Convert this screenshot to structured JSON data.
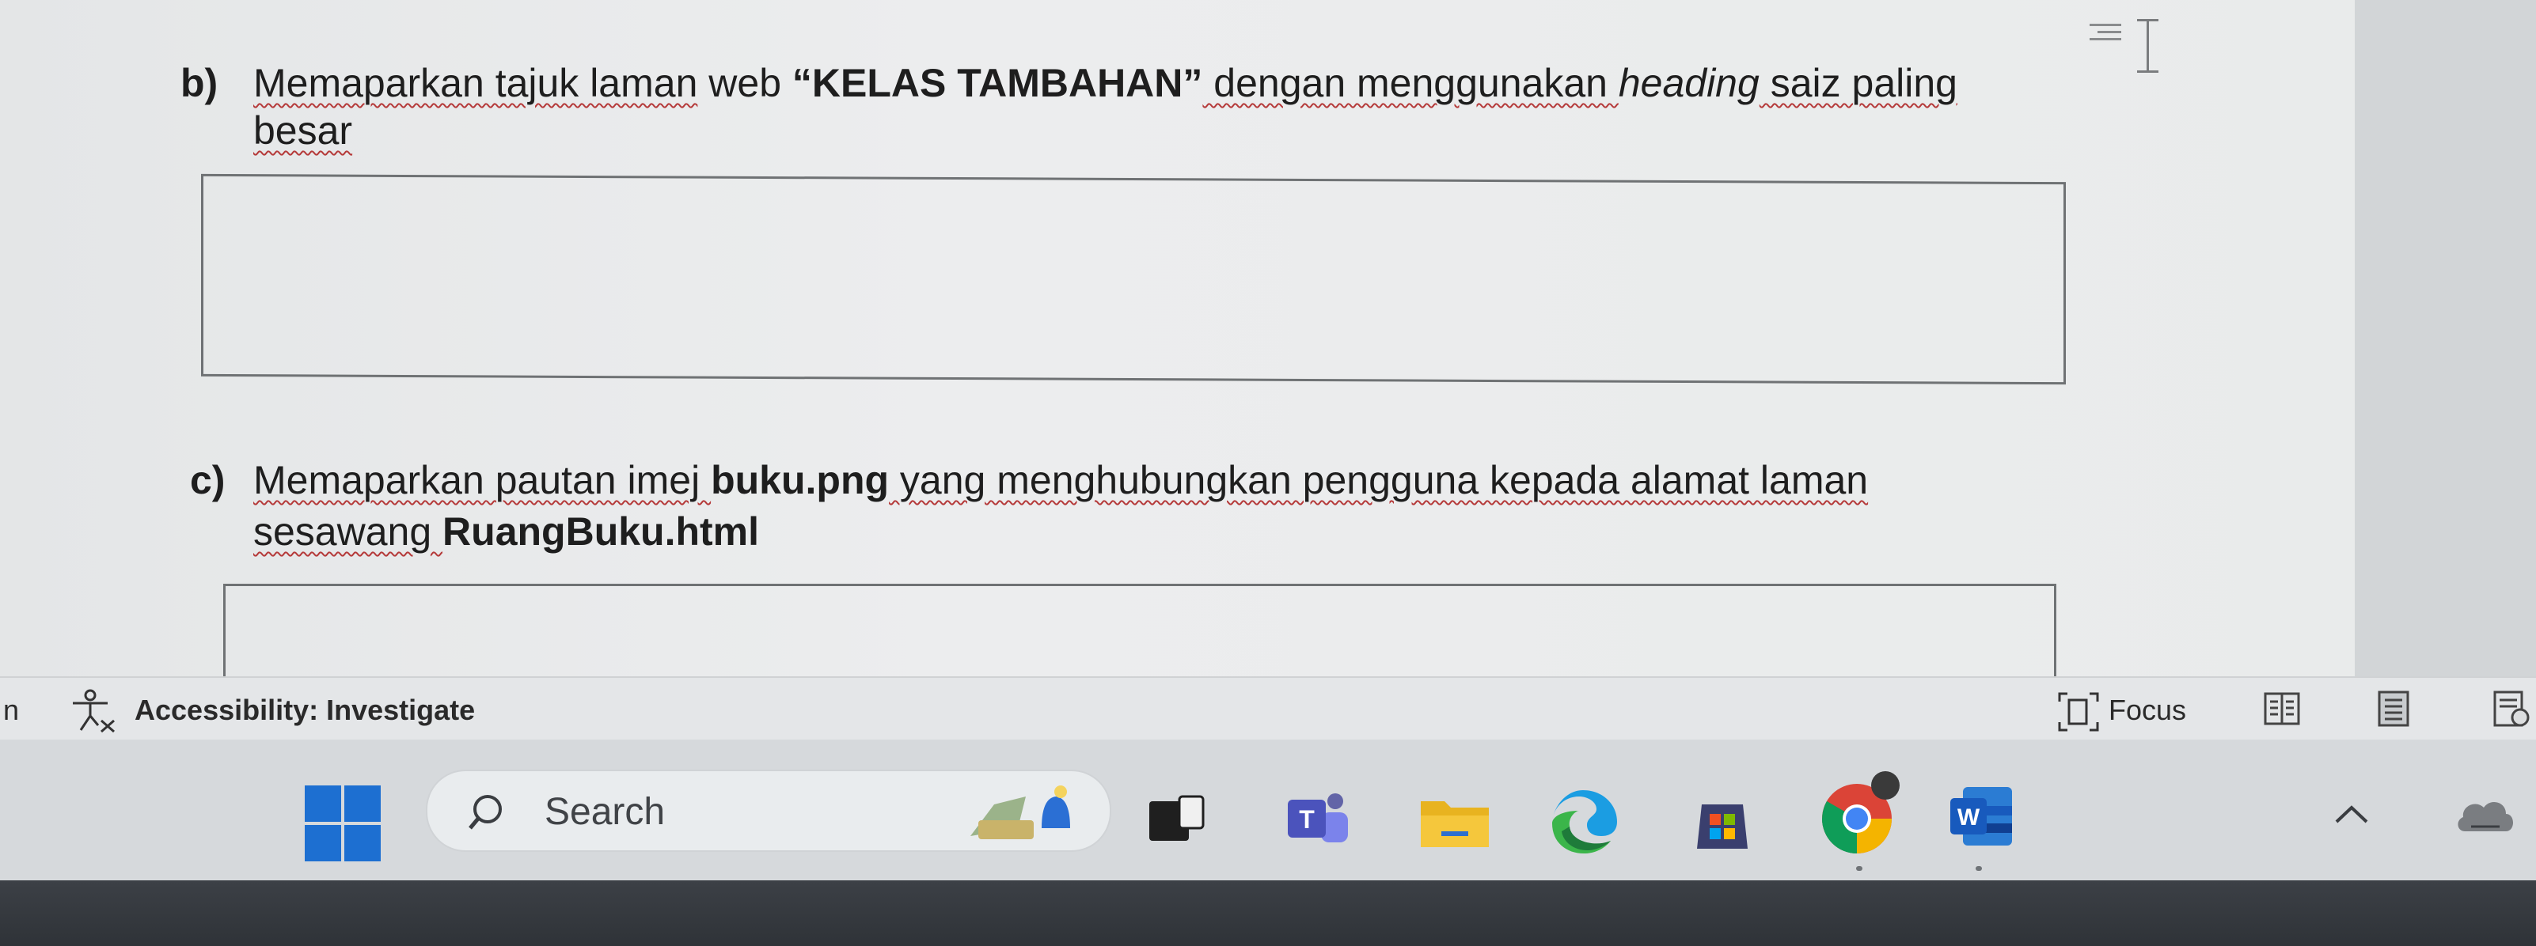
{
  "document": {
    "question_b": {
      "letter": "b)",
      "line1_part1": "Memaparkan tajuk laman",
      "line1_part2": " web ",
      "line1_bold": "“KELAS TAMBAHAN”",
      "line1_part3": " dengan menggunakan ",
      "line1_italic": "heading",
      "line1_part4": " saiz paling",
      "line2": "besar"
    },
    "question_c": {
      "letter": "c)",
      "line1_part1": "Memaparkan pautan imej ",
      "line1_bold": "buku.png",
      "line1_part2": " yang menghubungkan pengguna kepada alamat laman",
      "line2_part1": "sesawang ",
      "line2_bold": "RuangBuku.html"
    }
  },
  "status_bar": {
    "page_indicator": "n",
    "accessibility": "Accessibility: Investigate",
    "focus_label": "Focus"
  },
  "taskbar": {
    "search_placeholder": "Search",
    "apps": [
      "start-icon",
      "widgets-icon",
      "task-view-icon",
      "teams-icon",
      "file-explorer-icon",
      "edge-icon",
      "store-icon",
      "chrome-icon",
      "word-icon"
    ],
    "tray": [
      "chevron-up-icon",
      "onedrive-icon"
    ]
  },
  "colors": {
    "spellcheck": "#b53a3a",
    "word_blue": "#1f5fbf",
    "taskbar_bg": "#d6d9dc"
  }
}
